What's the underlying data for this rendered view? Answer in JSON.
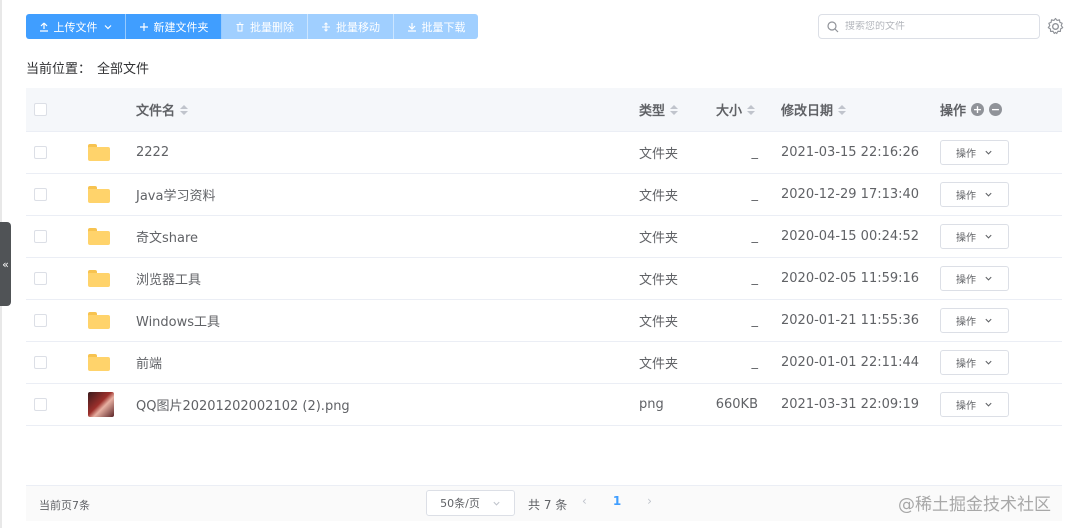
{
  "toolbar": {
    "upload": "上传文件",
    "new_folder": "新建文件夹",
    "batch_delete": "批量删除",
    "batch_move": "批量移动",
    "batch_download": "批量下载"
  },
  "search": {
    "placeholder": "搜索您的文件"
  },
  "breadcrumb": {
    "label": "当前位置：",
    "path": "全部文件"
  },
  "table": {
    "headers": {
      "name": "文件名",
      "type": "类型",
      "size": "大小",
      "date": "修改日期",
      "op": "操作"
    },
    "rows": [
      {
        "name": "2222",
        "type": "文件夹",
        "size": "_",
        "date": "2021-03-15 22:16:26",
        "op": "操作",
        "kind": "folder"
      },
      {
        "name": "Java学习资料",
        "type": "文件夹",
        "size": "_",
        "date": "2020-12-29 17:13:40",
        "op": "操作",
        "kind": "folder"
      },
      {
        "name": "奇文share",
        "type": "文件夹",
        "size": "_",
        "date": "2020-04-15 00:24:52",
        "op": "操作",
        "kind": "folder"
      },
      {
        "name": "浏览器工具",
        "type": "文件夹",
        "size": "_",
        "date": "2020-02-05 11:59:16",
        "op": "操作",
        "kind": "folder"
      },
      {
        "name": "Windows工具",
        "type": "文件夹",
        "size": "_",
        "date": "2020-01-21 11:55:36",
        "op": "操作",
        "kind": "folder"
      },
      {
        "name": "前端",
        "type": "文件夹",
        "size": "_",
        "date": "2020-01-01 22:11:44",
        "op": "操作",
        "kind": "folder"
      },
      {
        "name": "QQ图片20201202002102 (2).png",
        "type": "png",
        "size": "660KB",
        "date": "2021-03-31 22:09:19",
        "op": "操作",
        "kind": "image"
      }
    ]
  },
  "footer": {
    "count": "当前页7条",
    "page_size": "50条/页",
    "total": "共 7 条",
    "current_page": "1"
  },
  "side_handle": "«",
  "watermark": "@稀土掘金技术社区",
  "colors": {
    "primary": "#409eff",
    "disabled": "#a0cfff",
    "folder": "#ffd36b"
  }
}
